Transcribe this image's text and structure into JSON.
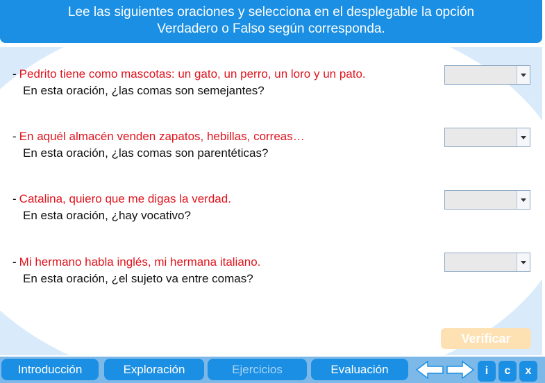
{
  "header": {
    "line1": "Lee las siguientes oraciones y selecciona en el desplegable la opción",
    "line2": "Verdadero o Falso según corresponda."
  },
  "questions": [
    {
      "dash": "-",
      "sentence": "Pedrito tiene como mascotas: un gato, un perro, un loro y un pato.",
      "prompt": "En esta oración, ¿las comas son semejantes?",
      "selected": ""
    },
    {
      "dash": "-",
      "sentence": "En aquél almacén venden zapatos, hebillas, correas…",
      "prompt": "En esta oración, ¿las comas son parentéticas?",
      "selected": ""
    },
    {
      "dash": "-",
      "sentence": "Catalina, quiero que me digas la verdad.",
      "prompt": "En esta oración, ¿hay vocativo?",
      "selected": ""
    },
    {
      "dash": "-",
      "sentence": "Mi hermano habla inglés, mi hermana italiano.",
      "prompt": "En esta oración, ¿el sujeto va entre comas?",
      "selected": ""
    }
  ],
  "verify_label": "Verificar",
  "nav": {
    "intro": "Introducción",
    "exploration": "Exploración",
    "exercises": "Ejercicios",
    "evaluation": "Evaluación",
    "info": "i",
    "credits": "c",
    "close": "x"
  },
  "colors": {
    "brand_blue": "#1a8fe3",
    "sentence_red": "#e0141e",
    "verify_disabled": "#fde1b2"
  },
  "icons": {
    "prev": "arrow-left-icon",
    "next": "arrow-right-icon",
    "dropdown": "chevron-down-icon"
  }
}
